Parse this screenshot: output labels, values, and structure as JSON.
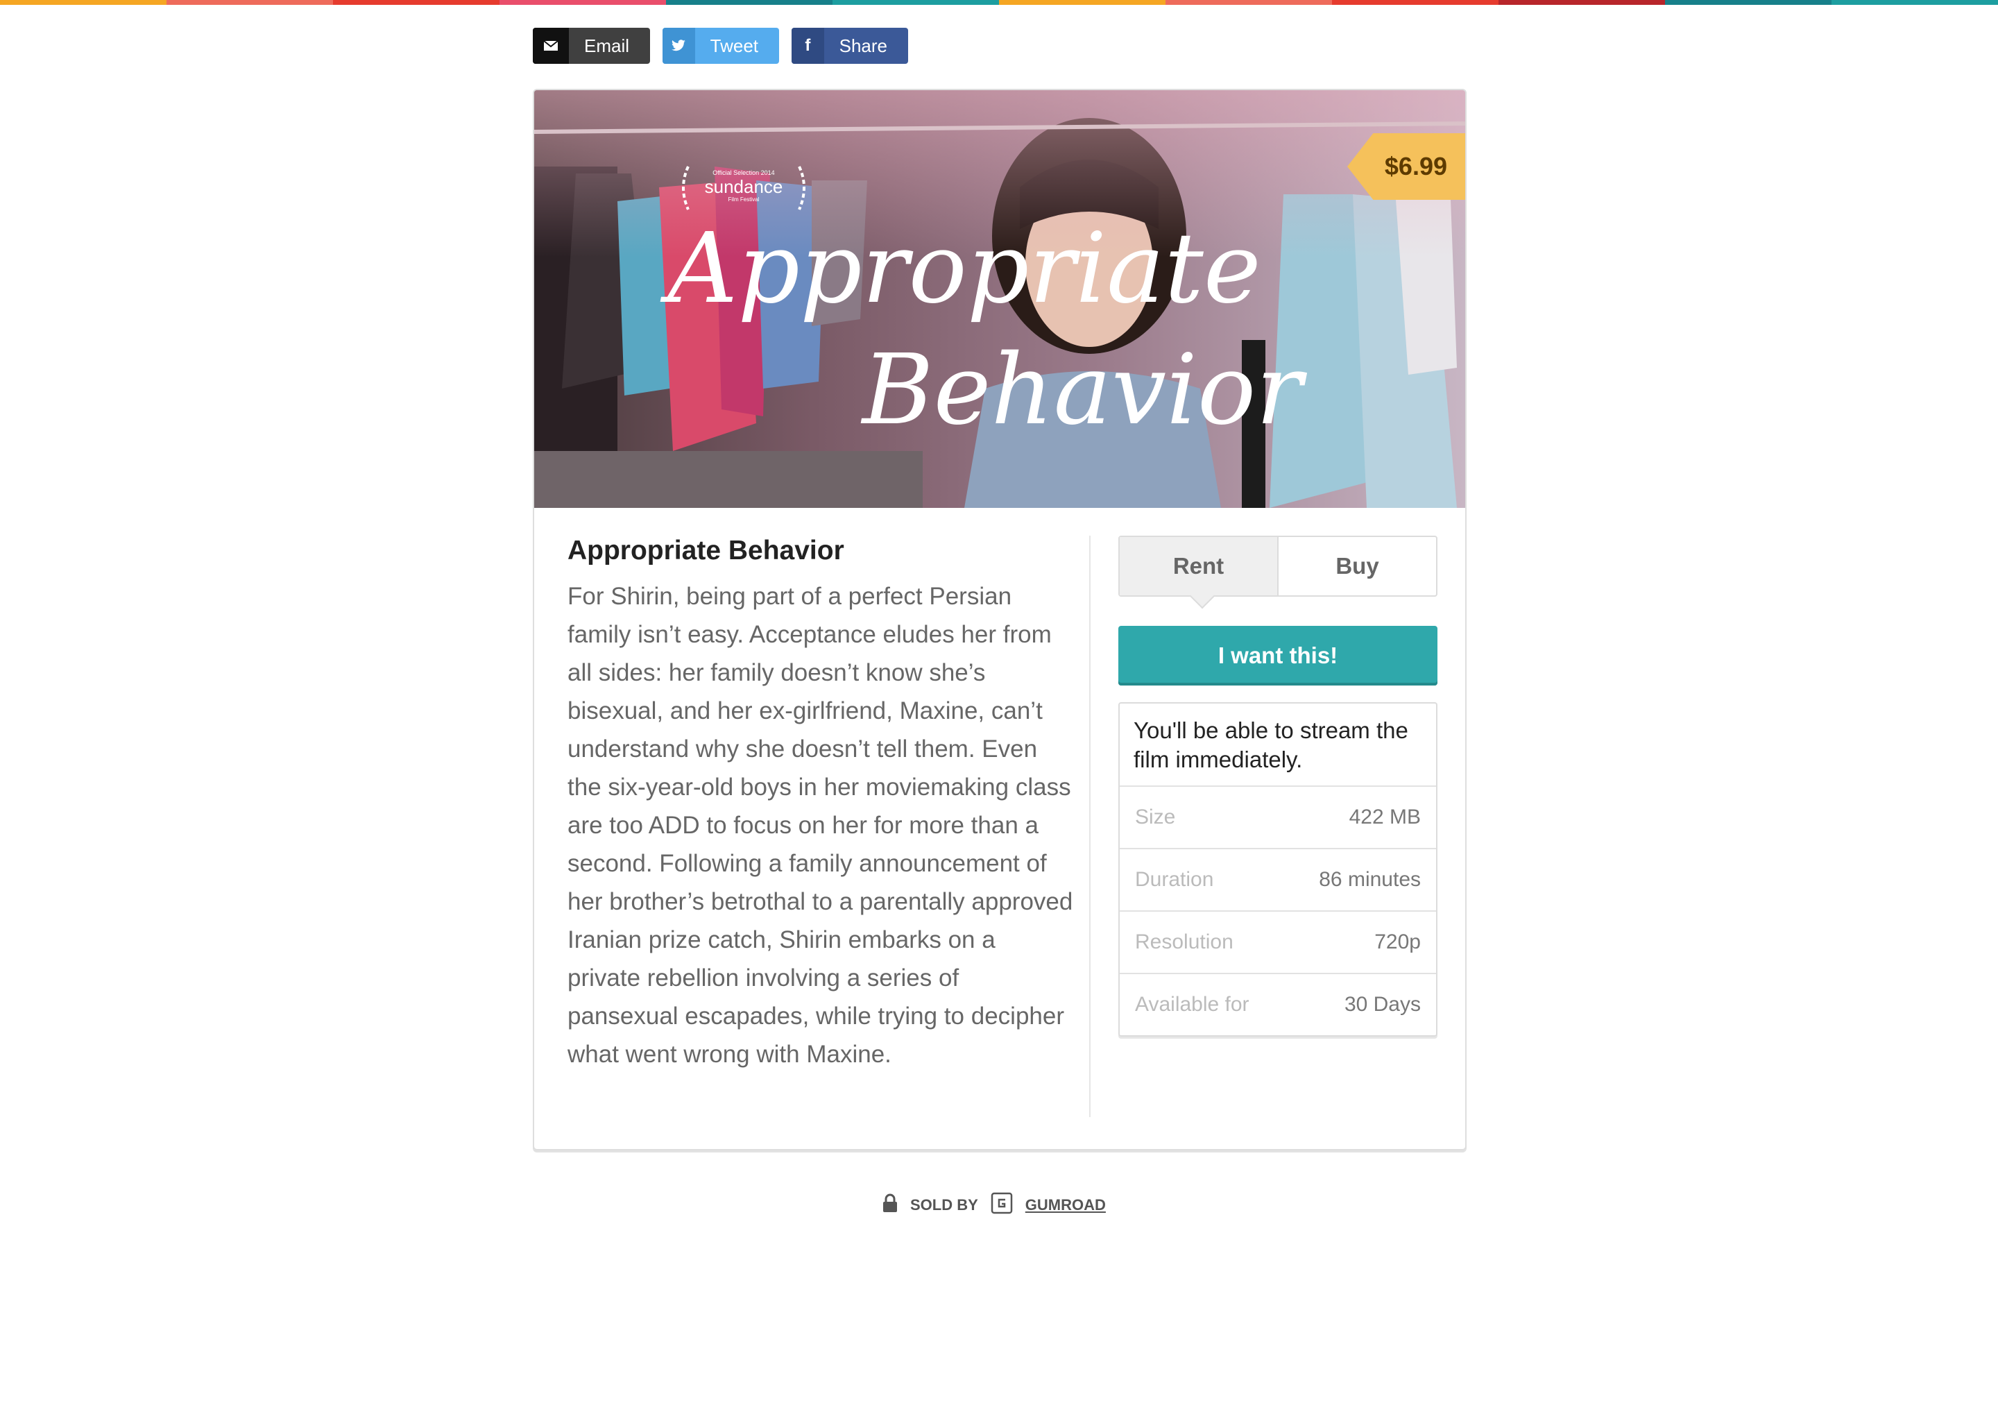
{
  "stripe_colors": [
    "#f5a623",
    "#ee6b5b",
    "#e63b2e",
    "#e94e6b",
    "#17808a",
    "#1d9ea0",
    "#f5a623",
    "#ee6b5b",
    "#e63b2e",
    "#b8262b",
    "#17808a",
    "#1d9ea0"
  ],
  "share": {
    "email_label": "Email",
    "tweet_label": "Tweet",
    "share_label": "Share",
    "email_icon": "envelope-icon",
    "tweet_icon": "twitter-icon",
    "share_icon": "facebook-icon"
  },
  "hero": {
    "title_line1": "Appropriate",
    "title_line2": "Behavior",
    "laurel_text": "sundance",
    "laurel_top": "Official Selection 2014",
    "laurel_bottom": "Film Festival",
    "price": "$6.99"
  },
  "product": {
    "title": "Appropriate Behavior",
    "description": "For Shirin, being part of a perfect Persian family isn’t easy. Acceptance eludes her from all sides: her family doesn’t know she’s bisexual, and her ex-girlfriend, Maxine, can’t understand why she doesn’t tell them. Even the six-year-old boys in her moviemaking class are too ADD to focus on her for more than a second. Following a family announcement of her brother’s betrothal to a parentally approved Iranian prize catch, Shirin embarks on a private rebellion involving a series of pansexual escapades, while trying to decipher what went wrong with Maxine."
  },
  "purchase": {
    "tab_rent": "Rent",
    "tab_buy": "Buy",
    "cta": "I want this!",
    "note": "You'll be able to stream the film immediately.",
    "specs": [
      {
        "label": "Size",
        "value": "422 MB"
      },
      {
        "label": "Duration",
        "value": "86 minutes"
      },
      {
        "label": "Resolution",
        "value": "720p"
      },
      {
        "label": "Available for",
        "value": "30 Days"
      }
    ]
  },
  "footer": {
    "sold_by": "SOLD BY",
    "seller": "GUMROAD"
  }
}
